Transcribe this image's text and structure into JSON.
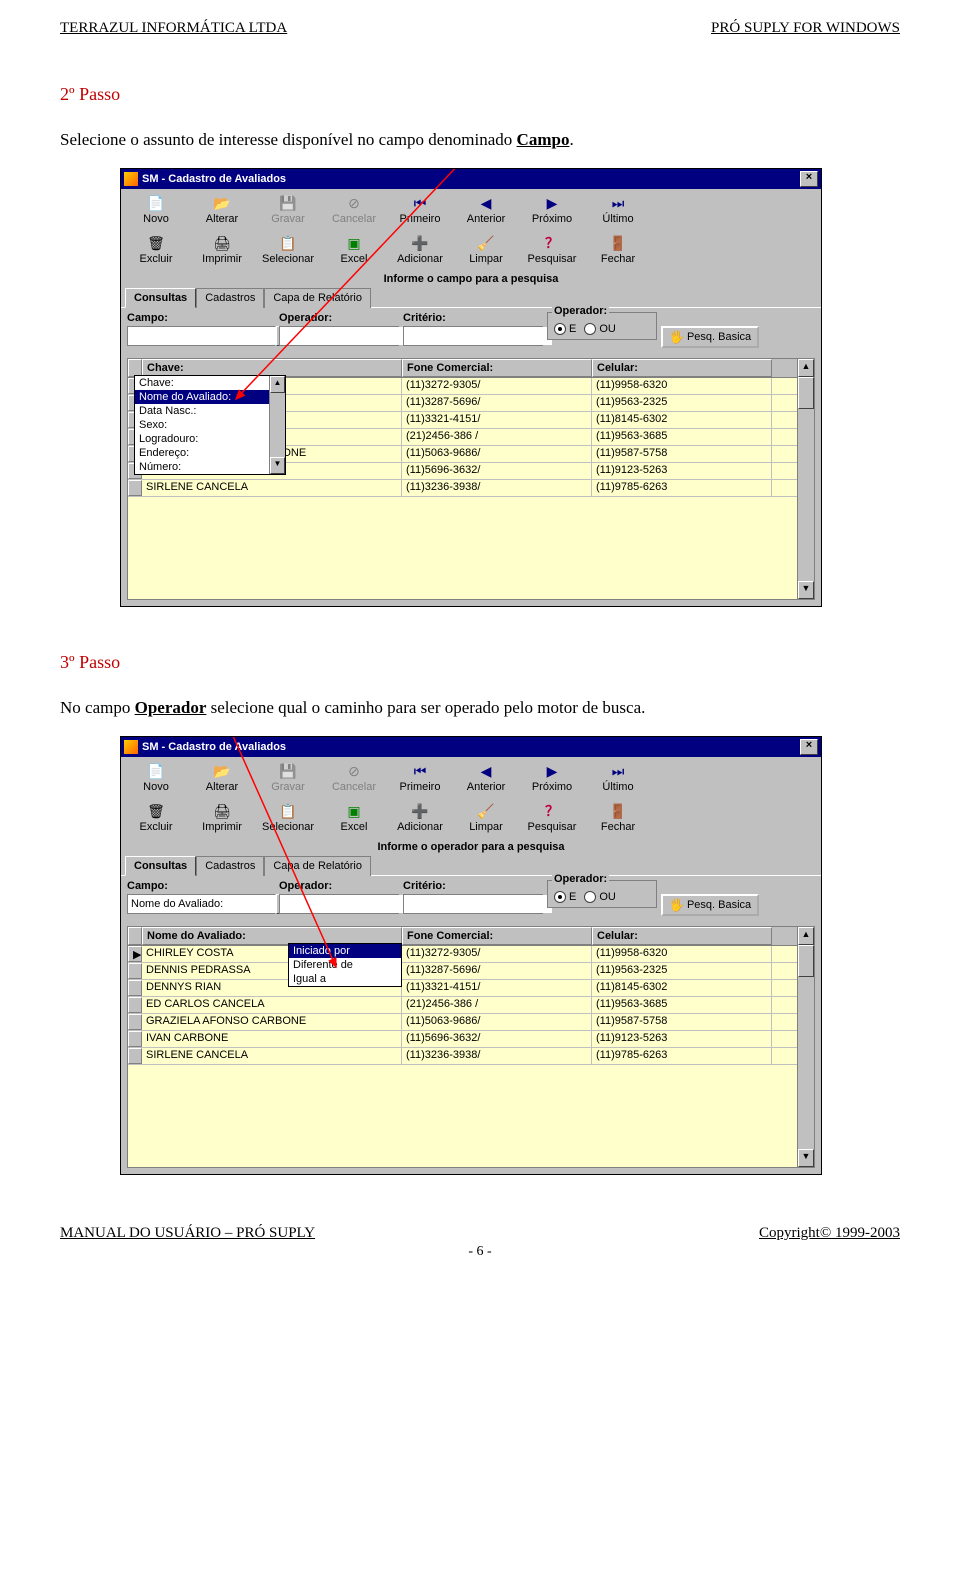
{
  "header": {
    "left": "TERRAZUL INFORMÁTICA LTDA",
    "right": "PRÓ SUPLY FOR WINDOWS"
  },
  "passo2": {
    "title": "2º Passo",
    "text_pre": "Selecione o assunto de interesse disponível no campo denominado ",
    "text_link": "Campo",
    "text_post": "."
  },
  "passo3": {
    "title": "3º Passo",
    "text_pre": "No campo ",
    "text_link": "Operador",
    "text_post": " selecione qual o caminho para ser operado pelo motor de busca."
  },
  "app": {
    "title": "SM - Cadastro de Avaliados",
    "toolbar1": [
      {
        "label": "Novo",
        "icon": "ic-novo"
      },
      {
        "label": "Alterar",
        "icon": "ic-alterar"
      },
      {
        "label": "Gravar",
        "icon": "ic-gravar",
        "disabled": true
      },
      {
        "label": "Cancelar",
        "icon": "ic-cancelar",
        "disabled": true
      },
      {
        "label": "Primeiro",
        "icon": "ic-primeiro"
      },
      {
        "label": "Anterior",
        "icon": "ic-anterior"
      },
      {
        "label": "Próximo",
        "icon": "ic-proximo"
      },
      {
        "label": "Último",
        "icon": "ic-ultimo"
      }
    ],
    "toolbar2": [
      {
        "label": "Excluir",
        "icon": "ic-excluir"
      },
      {
        "label": "Imprimir",
        "icon": "ic-imprimir"
      },
      {
        "label": "Selecionar",
        "icon": "ic-selecionar"
      },
      {
        "label": "Excel",
        "icon": "ic-excel"
      },
      {
        "label": "Adicionar",
        "icon": "ic-adicionar"
      },
      {
        "label": "Limpar",
        "icon": "ic-limpar"
      },
      {
        "label": "Pesquisar",
        "icon": "ic-pesquisar"
      },
      {
        "label": "Fechar",
        "icon": "ic-fechar"
      }
    ],
    "instruction1": "Informe o campo para a pesquisa",
    "instruction2": "Informe o operador para a pesquisa",
    "tabs": [
      "Consultas",
      "Cadastros",
      "Capa de Relatório"
    ],
    "labels": {
      "campo": "Campo:",
      "operador": "Operador:",
      "criterio": "Critério:",
      "operadorgrp": "Operador:",
      "e": "E",
      "ou": "OU",
      "pesq": "Pesq. Basica"
    },
    "campo_value_win2": "Nome do Avaliado:",
    "grid_head": {
      "c1_win1": "Chave:",
      "c1_win2": "Nome do Avaliado:",
      "c2": "Fone Comercial:",
      "c3": "Celular:"
    },
    "dd_campo": [
      "Chave:",
      "Nome do Avaliado:",
      "Data Nasc.:",
      "Sexo:",
      "Logradouro:",
      "Endereço:",
      "Número:"
    ],
    "dd_operador": [
      "Iniciado por",
      "Diferente de",
      "Igual a"
    ],
    "grid_rows_full": [
      {
        "name": "CHIRLEY COSTA",
        "fone": "(11)3272-9305/",
        "cel": "(11)9958-6320"
      },
      {
        "name": "DENNIS PEDRASSA",
        "fone": "(11)3287-5696/",
        "cel": "(11)9563-2325"
      },
      {
        "name": "DENNYS RIAN",
        "fone": "(11)3321-4151/",
        "cel": "(11)8145-6302"
      },
      {
        "name": "ED CARLOS CANCELA",
        "fone": "(21)2456-386 /",
        "cel": "(11)9563-3685"
      },
      {
        "name": "GRAZIELA AFONSO CARBONE",
        "fone": "(11)5063-9686/",
        "cel": "(11)9587-5758"
      },
      {
        "name": "IVAN CARBONE",
        "fone": "(11)5696-3632/",
        "cel": "(11)9123-5263"
      },
      {
        "name": "SIRLENE CANCELA",
        "fone": "(11)3236-3938/",
        "cel": "(11)9785-6263"
      }
    ]
  },
  "footer": {
    "left": "MANUAL DO USUÁRIO – PRÓ SUPLY",
    "right": "Copyright©  1999-2003",
    "page": "- 6 -"
  }
}
